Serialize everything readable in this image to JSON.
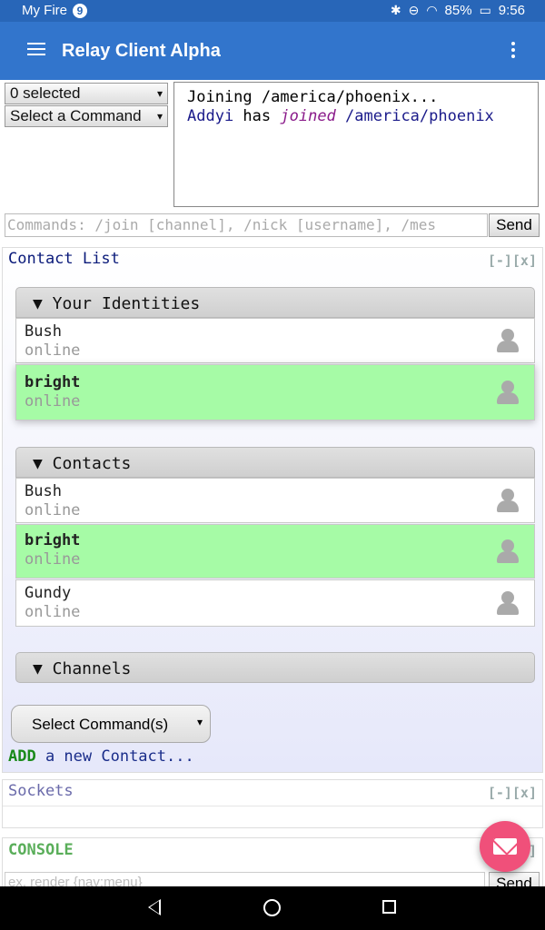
{
  "status_bar": {
    "carrier": "My Fire",
    "notification_count": "9",
    "battery": "85%",
    "time": "9:56"
  },
  "app_bar": {
    "title": "Relay Client Alpha"
  },
  "top": {
    "selection_dropdown": "0 selected",
    "command_dropdown": "Select a Command",
    "chat_lines": [
      {
        "text": "Joining /america/phoenix..."
      },
      {
        "nick": "Addyi",
        "middle": " has ",
        "verb": "joined",
        "channel": " /america/phoenix"
      }
    ],
    "command_placeholder": "Commands: /join [channel], /nick [username], /mes",
    "send_label": "Send"
  },
  "contact_list": {
    "title": "Contact List",
    "controls": "[-][x]",
    "identities_header": "▼ Your Identities",
    "identities": [
      {
        "name": "Bush",
        "status": "online",
        "active": false
      },
      {
        "name": "bright",
        "status": "online",
        "active": true
      }
    ],
    "contacts_header": "▼ Contacts",
    "contacts": [
      {
        "name": "Bush",
        "status": "online",
        "active": false
      },
      {
        "name": "bright",
        "status": "online",
        "active": true
      },
      {
        "name": "Gundy",
        "status": "online",
        "active": false
      }
    ],
    "channels_header": "▼ Channels",
    "select_commands": "Select Command(s)",
    "add_keyword": "ADD",
    "add_text": " a new Contact..."
  },
  "sockets": {
    "title": "Sockets",
    "controls": "[-][x]"
  },
  "console": {
    "title": "CONSOLE",
    "controls": "]",
    "input_placeholder": "ex. render {nav:menu}",
    "send_label": "Send"
  },
  "colors": {
    "status_bar": "#2866b8",
    "app_bar": "#3275cc",
    "active_row": "#a6fba6",
    "fab": "#f0507a",
    "console_title": "#5aae5a",
    "sockets_title": "#6a6aaa"
  },
  "icons": {
    "menu": "hamburger-menu-icon",
    "overflow": "overflow-menu-icon",
    "avatar": "user-avatar-icon",
    "fab": "mail-icon"
  }
}
